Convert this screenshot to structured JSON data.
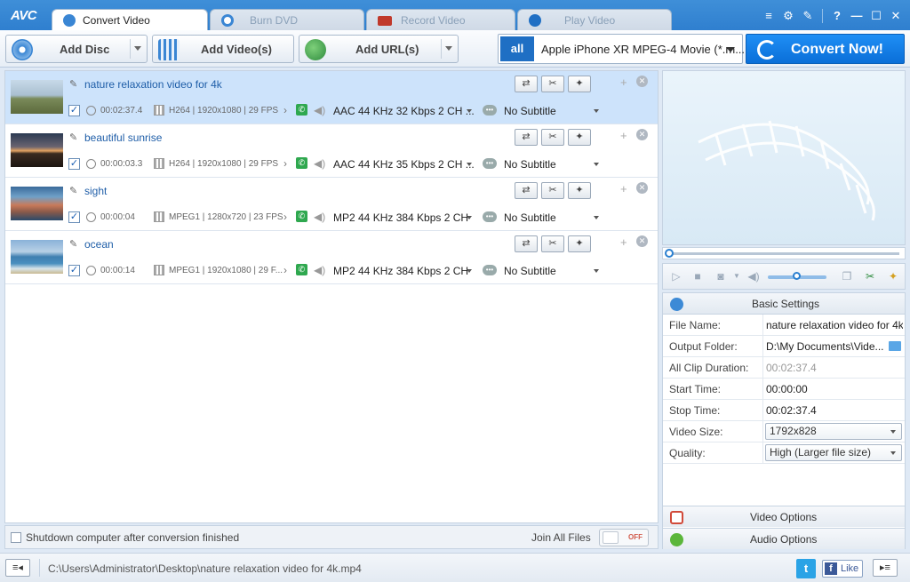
{
  "app": {
    "logo": "AVC"
  },
  "tabs": [
    {
      "label": "Convert Video",
      "active": true,
      "icon": "convert-video-icon"
    },
    {
      "label": "Burn DVD",
      "active": false,
      "icon": "disc-icon"
    },
    {
      "label": "Record Video",
      "active": false,
      "icon": "record-icon"
    },
    {
      "label": "Play Video",
      "active": false,
      "icon": "play-icon"
    }
  ],
  "window_controls": {
    "menu": "≡",
    "settings": "⚙",
    "tools": "✎",
    "help": "?",
    "minimize": "—",
    "maximize": "☐",
    "close": "✕"
  },
  "toolbar": {
    "add_disc": "Add Disc",
    "add_videos": "Add Video(s)",
    "add_url": "Add URL(s)",
    "profile_icon_text": "all",
    "profile": "Apple iPhone XR MPEG-4 Movie (*.m...",
    "convert": "Convert Now!"
  },
  "files": [
    {
      "name": "nature relaxation video for 4k",
      "checked": true,
      "duration": "00:02:37.4",
      "video_info": "H264 | 1920x1080 | 29 FPS",
      "audio": "AAC 44 KHz 32 Kbps 2 CH ...",
      "subtitle": "No Subtitle",
      "selected": true
    },
    {
      "name": "beautiful sunrise",
      "checked": true,
      "duration": "00:00:03.3",
      "video_info": "H264 | 1920x1080 | 29 FPS",
      "audio": "AAC 44 KHz 35 Kbps 2 CH ...",
      "subtitle": "No Subtitle",
      "selected": false
    },
    {
      "name": "sight",
      "checked": true,
      "duration": "00:00:04",
      "video_info": "MPEG1 | 1280x720 | 23 FPS",
      "audio": "MP2 44 KHz 384 Kbps 2 CH",
      "subtitle": "No Subtitle",
      "selected": false
    },
    {
      "name": "ocean",
      "checked": true,
      "duration": "00:00:14",
      "video_info": "MPEG1 | 1920x1080 | 29 F...",
      "audio": "MP2 44 KHz 384 Kbps 2 CH",
      "subtitle": "No Subtitle",
      "selected": false
    }
  ],
  "row_buttons": {
    "rotate": "⇄",
    "cut": "✂",
    "effects": "✦",
    "add": "+",
    "remove": "✕"
  },
  "options": {
    "shutdown_label": "Shutdown computer after conversion finished",
    "join_label": "Join All Files",
    "join_toggle": "OFF"
  },
  "settings": {
    "header": "Basic Settings",
    "rows": [
      {
        "key": "File Name:",
        "value": "nature relaxation video for 4k"
      },
      {
        "key": "Output Folder:",
        "value": "D:\\My Documents\\Vide..."
      },
      {
        "key": "All Clip Duration:",
        "value": "00:02:37.4"
      },
      {
        "key": "Start Time:",
        "value": "00:00:00"
      },
      {
        "key": "Stop Time:",
        "value": "00:02:37.4"
      },
      {
        "key": "Video Size:",
        "value": "1792x828"
      },
      {
        "key": "Quality:",
        "value": "High (Larger file size)"
      }
    ],
    "video_options": "Video Options",
    "audio_options": "Audio Options"
  },
  "status": {
    "path": "C:\\Users\\Administrator\\Desktop\\nature relaxation video for 4k.mp4",
    "twitter": "t",
    "facebook_f": "f",
    "facebook_like": "Like"
  },
  "colors": {
    "accent": "#2f7fcf",
    "convert_button": "#0a6fd8",
    "selected_row": "#cde3fb",
    "file_name": "#1f5ea8"
  }
}
